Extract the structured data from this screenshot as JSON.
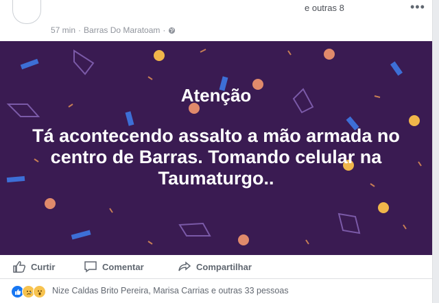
{
  "header": {
    "others_link": "e outras 8",
    "more_label": "•••",
    "time": "57 min",
    "separator": "·",
    "location": "Barras Do Maratoam",
    "separator2": "·",
    "privacy_icon": "globe-icon"
  },
  "banner": {
    "title": "Atenção",
    "message": "Tá acontecendo assalto a mão armada no centro de Barras. Tomando celular na Taumaturgo..",
    "background_color": "#3a1b52"
  },
  "actions": {
    "like_label": "Curtir",
    "comment_label": "Comentar",
    "share_label": "Compartilhar"
  },
  "reactions": {
    "icons": [
      "like-icon",
      "sad-icon",
      "wow-icon"
    ],
    "summary": "Nize Caldas Brito Pereira, Marisa Carrias e outras 33 pessoas"
  },
  "colors": {
    "accent": "#1877f2",
    "text_secondary": "#606770"
  }
}
